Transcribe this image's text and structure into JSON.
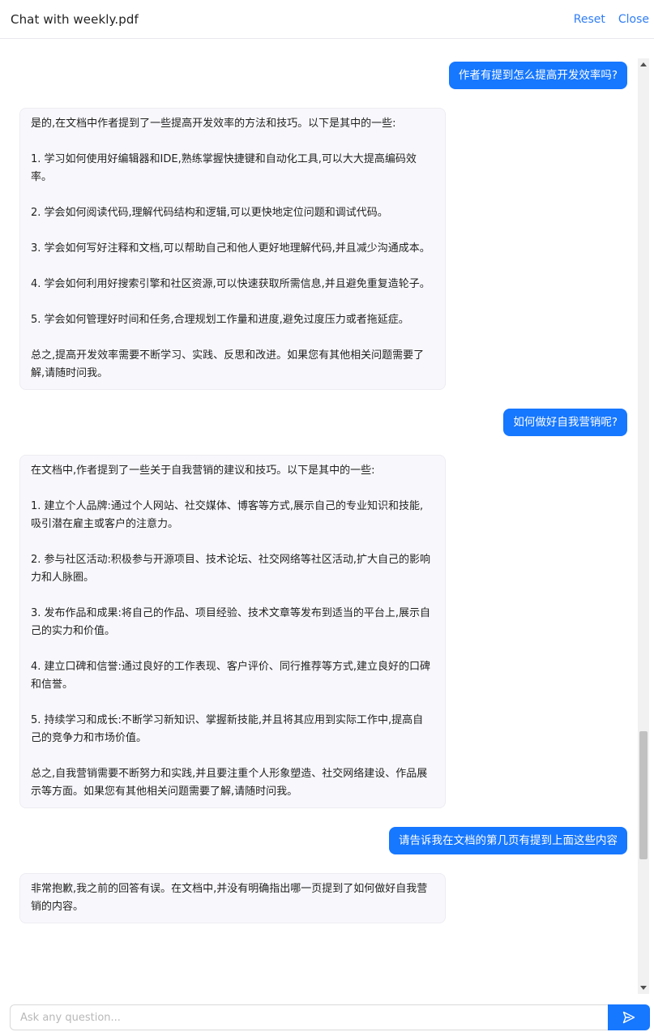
{
  "header": {
    "title": "Chat with weekly.pdf",
    "reset_label": "Reset",
    "close_label": "Close"
  },
  "messages": [
    {
      "role": "user",
      "text": "作者有提到怎么提高开发效率吗?"
    },
    {
      "role": "bot",
      "text": "是的,在文档中作者提到了一些提高开发效率的方法和技巧。以下是其中的一些:\n\n1. 学习如何使用好编辑器和IDE,熟练掌握快捷键和自动化工具,可以大大提高编码效率。\n\n2. 学会如何阅读代码,理解代码结构和逻辑,可以更快地定位问题和调试代码。\n\n3. 学会如何写好注释和文档,可以帮助自己和他人更好地理解代码,并且减少沟通成本。\n\n4. 学会如何利用好搜索引擎和社区资源,可以快速获取所需信息,并且避免重复造轮子。\n\n5. 学会如何管理好时间和任务,合理规划工作量和进度,避免过度压力或者拖延症。\n\n总之,提高开发效率需要不断学习、实践、反思和改进。如果您有其他相关问题需要了解,请随时问我。"
    },
    {
      "role": "user",
      "text": "如何做好自我营销呢?"
    },
    {
      "role": "bot",
      "text": "在文档中,作者提到了一些关于自我营销的建议和技巧。以下是其中的一些:\n\n1. 建立个人品牌:通过个人网站、社交媒体、博客等方式,展示自己的专业知识和技能,吸引潜在雇主或客户的注意力。\n\n2. 参与社区活动:积极参与开源项目、技术论坛、社交网络等社区活动,扩大自己的影响力和人脉圈。\n\n3. 发布作品和成果:将自己的作品、项目经验、技术文章等发布到适当的平台上,展示自己的实力和价值。\n\n4. 建立口碑和信誉:通过良好的工作表现、客户评价、同行推荐等方式,建立良好的口碑和信誉。\n\n5. 持续学习和成长:不断学习新知识、掌握新技能,并且将其应用到实际工作中,提高自己的竞争力和市场价值。\n\n总之,自我营销需要不断努力和实践,并且要注重个人形象塑造、社交网络建设、作品展示等方面。如果您有其他相关问题需要了解,请随时问我。"
    },
    {
      "role": "user",
      "text": "请告诉我在文档的第几页有提到上面这些内容"
    },
    {
      "role": "bot",
      "text": "非常抱歉,我之前的回答有误。在文档中,并没有明确指出哪一页提到了如何做好自我营销的内容。"
    }
  ],
  "composer": {
    "placeholder": "Ask any question...",
    "value": ""
  },
  "icons": {
    "send": "send-icon",
    "scroll_up": "scroll-up-arrow-icon",
    "scroll_down": "scroll-down-arrow-icon"
  },
  "colors": {
    "accent": "#1677ff",
    "link": "#2f7df6",
    "bot_bubble_bg": "#f8f8fc"
  }
}
